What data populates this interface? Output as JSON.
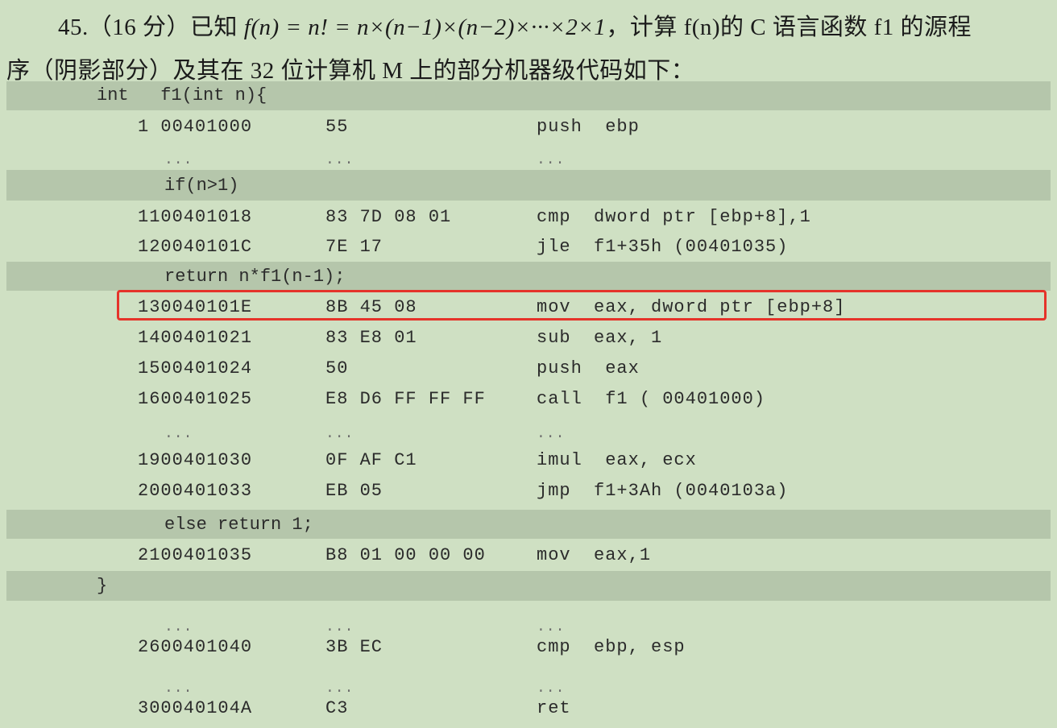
{
  "question": {
    "number_and_points": "45.（16 分）已知 ",
    "formula_lhs": "f",
    "formula_rest": "(n) = n! = n×(n−1)×(n−2)×···×2×1",
    "line1_tail": "，计算 f(n)的 C 语言函数 f1 的源程",
    "line2": "序（阴影部分）及其在 32 位计算机 M 上的部分机器级代码如下："
  },
  "code": {
    "source_lines": {
      "s1": "int   f1(int n){",
      "s2": "if(n>1)",
      "s3": "return n*f1(n-1);",
      "s4": "else return 1;",
      "s5": "}"
    },
    "rows": [
      {
        "addr": "1 00401000",
        "bytes": "55",
        "asm": "push  ebp"
      },
      {
        "addr": "...",
        "bytes": "...",
        "asm": "..."
      },
      {
        "addr": "1100401018",
        "bytes": "83 7D 08 01",
        "asm": "cmp  dword ptr [ebp+8],1"
      },
      {
        "addr": "120040101C",
        "bytes": "7E 17",
        "asm": "jle  f1+35h (00401035)"
      },
      {
        "addr": "130040101E",
        "bytes": "8B 45 08",
        "asm": "mov  eax, dword ptr [ebp+8]"
      },
      {
        "addr": "1400401021",
        "bytes": "83 E8 01",
        "asm": "sub  eax, 1"
      },
      {
        "addr": "1500401024",
        "bytes": "50",
        "asm": "push  eax"
      },
      {
        "addr": "1600401025",
        "bytes": "E8 D6 FF FF FF",
        "asm": "call  f1 ( 00401000)"
      },
      {
        "addr": "...",
        "bytes": "...",
        "asm": "..."
      },
      {
        "addr": "1900401030",
        "bytes": "0F AF C1",
        "asm": "imul  eax, ecx"
      },
      {
        "addr": "2000401033",
        "bytes": "EB 05",
        "asm": "jmp  f1+3Ah (0040103a)"
      },
      {
        "addr": "2100401035",
        "bytes": "B8 01 00 00 00",
        "asm": "mov  eax,1"
      },
      {
        "addr": "...",
        "bytes": "...",
        "asm": "..."
      },
      {
        "addr": "2600401040",
        "bytes": "3B EC",
        "asm": "cmp  ebp, esp"
      },
      {
        "addr": "...",
        "bytes": "...",
        "asm": "..."
      },
      {
        "addr": "300040104A",
        "bytes": "C3",
        "asm": "ret"
      }
    ]
  },
  "colors": {
    "background": "#cfe0c3",
    "shaded_source": "#b5c6ab",
    "highlight_box": "#e5332a"
  }
}
